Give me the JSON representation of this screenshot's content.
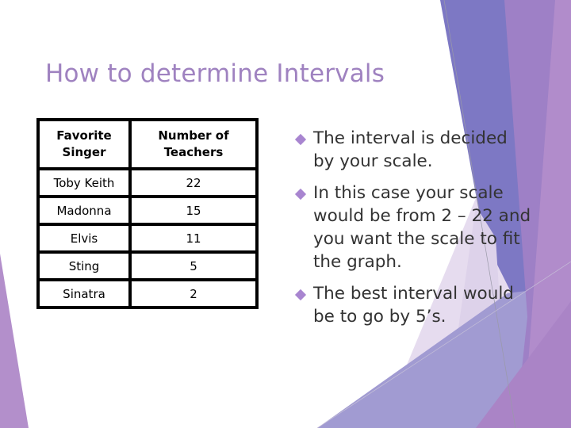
{
  "slide": {
    "title": "How to determine Intervals",
    "accent_color": "#9f82c0",
    "bullet_icon": "diamond-bullet-icon"
  },
  "table": {
    "headers": [
      "Favorite Singer",
      "Number of Teachers"
    ],
    "rows": [
      {
        "singer": "Toby Keith",
        "teachers": "22"
      },
      {
        "singer": "Madonna",
        "teachers": "15"
      },
      {
        "singer": "Elvis",
        "teachers": "11"
      },
      {
        "singer": "Sting",
        "teachers": "5"
      },
      {
        "singer": "Sinatra",
        "teachers": "2"
      }
    ]
  },
  "bullets": [
    "The interval is decided by your scale.",
    "In this case your scale would be from 2 – 22 and you want the scale to fit the graph.",
    "The best interval would be to go by 5’s."
  ]
}
